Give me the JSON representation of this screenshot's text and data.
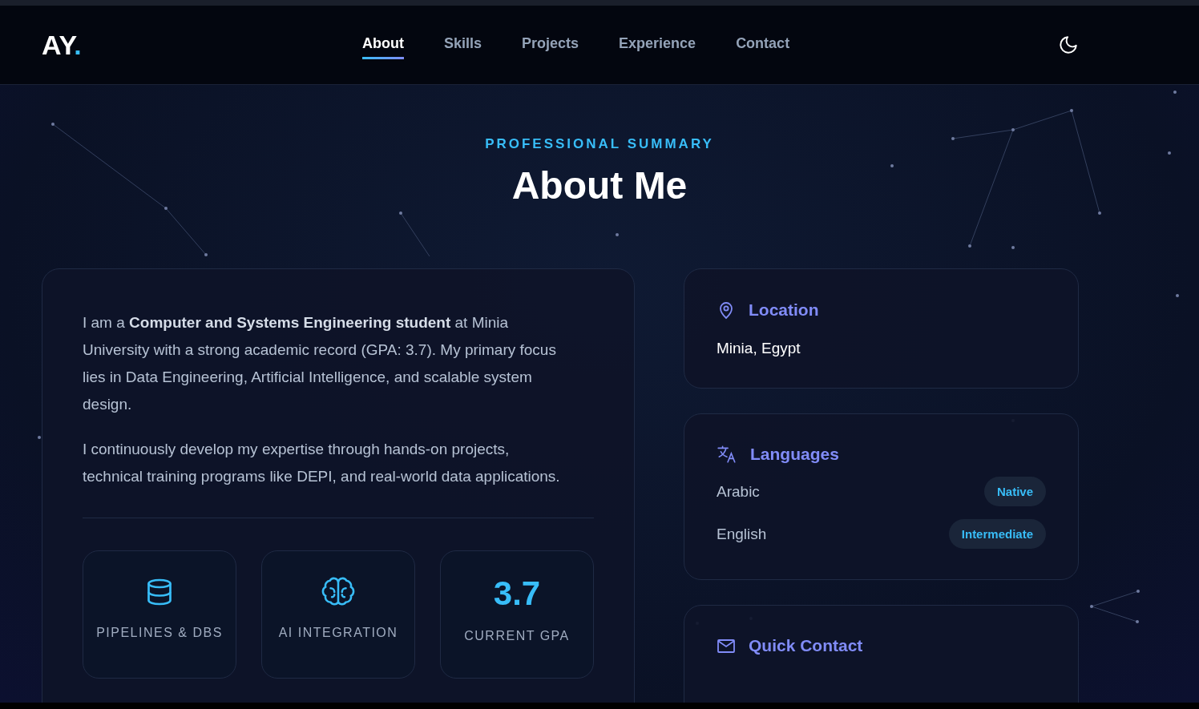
{
  "logo": {
    "text": "AY",
    "dot": "."
  },
  "nav": [
    {
      "label": "About",
      "selected": true
    },
    {
      "label": "Skills",
      "selected": false
    },
    {
      "label": "Projects",
      "selected": false
    },
    {
      "label": "Experience",
      "selected": false
    },
    {
      "label": "Contact",
      "selected": false
    }
  ],
  "section": {
    "eyebrow": "PROFESSIONAL SUMMARY",
    "title": "About Me"
  },
  "summary": {
    "paragraphs": [
      "I am a **Computer and Systems Engineering student** at Minia University with a strong academic record (GPA: 3.7). My primary focus lies in Data Engineering, Artificial Intelligence, and scalable system design.",
      "I continuously develop my expertise through hands-on projects, technical training programs like DEPI, and real-world data applications."
    ],
    "stats": [
      {
        "kind": "database",
        "label": "PIPELINES & DBS"
      },
      {
        "kind": "brain",
        "label": "AI INTEGRATION"
      },
      {
        "kind": "value",
        "value": "3.7",
        "label": "CURRENT GPA"
      }
    ]
  },
  "location": {
    "title": "Location",
    "value": "Minia, Egypt"
  },
  "languages": {
    "title": "Languages",
    "items": [
      {
        "name": "Arabic",
        "level": "Native"
      },
      {
        "name": "English",
        "level": "Intermediate"
      }
    ]
  },
  "quick_contact": {
    "title": "Quick Contact"
  }
}
